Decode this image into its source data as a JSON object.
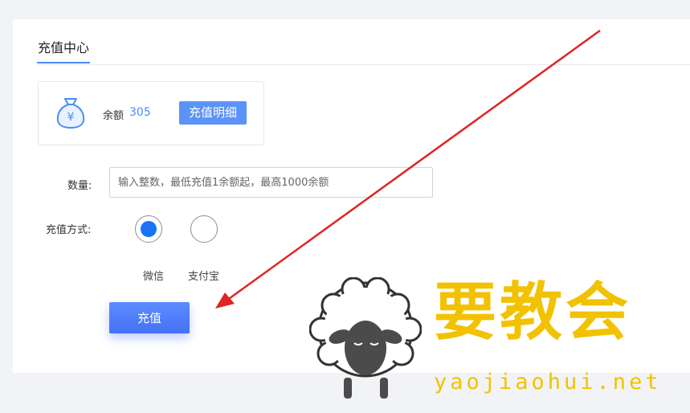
{
  "header": {
    "tab_label": "充值中心"
  },
  "balance": {
    "label": "余额",
    "value": "305",
    "detail_button": "充值明细",
    "icon": "money-bag-icon"
  },
  "form": {
    "quantity_label": "数量:",
    "quantity_placeholder": "输入整数，最低充值1余额起，最高1000余额",
    "quantity_value": "",
    "payment_label": "充值方式:",
    "payment_options": [
      {
        "label": "微信",
        "selected": true
      },
      {
        "label": "支付宝",
        "selected": false
      }
    ],
    "submit_label": "充值"
  },
  "watermark": {
    "title": "要教会",
    "url": "yaojiaohui.net"
  },
  "colors": {
    "accent": "#4a8cf7",
    "radio_selected": "#1a73f5",
    "annotation_arrow": "#e02424",
    "watermark": "#f2c200"
  }
}
